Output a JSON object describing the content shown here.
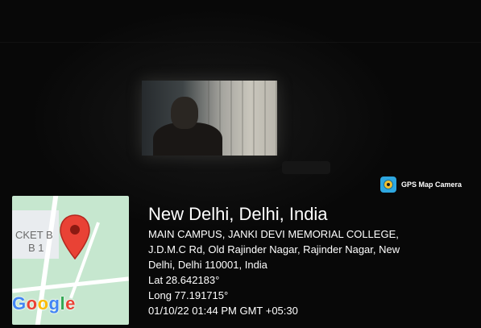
{
  "brand": {
    "label": "GPS Map Camera",
    "icon": "gps-map-camera-app-icon"
  },
  "map": {
    "label_line1": "CKET B",
    "label_line2": "B 1",
    "provider": "Google",
    "provider_colors": [
      "#4285f4",
      "#ea4335",
      "#fbbc05",
      "#4285f4",
      "#34a853",
      "#ea4335"
    ],
    "pin_color": "#e94235"
  },
  "location": {
    "city": "New Delhi, Delhi, India",
    "address_line1": "MAIN CAMPUS, JANKI DEVI MEMORIAL COLLEGE,",
    "address_line2": "J.D.M.C Rd, Old Rajinder Nagar, Rajinder Nagar, New",
    "address_line3": "Delhi, Delhi 110001, India",
    "latitude": "Lat 28.642183°",
    "longitude": "Long 77.191715°",
    "timestamp": "01/10/22 01:44 PM GMT +05:30"
  }
}
